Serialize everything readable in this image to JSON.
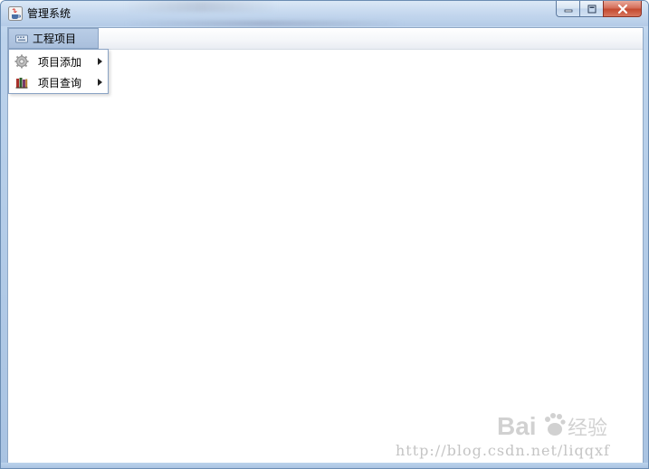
{
  "window": {
    "title": "管理系统",
    "controls": [
      "minimize",
      "maximize",
      "close"
    ]
  },
  "menubar": {
    "menus": [
      {
        "label": "工程项目",
        "icon": "keyboard-icon",
        "open": true,
        "items": [
          {
            "label": "项目添加",
            "icon": "gear-icon",
            "has_submenu": true
          },
          {
            "label": "项目查询",
            "icon": "books-icon",
            "has_submenu": true
          }
        ]
      }
    ]
  },
  "watermark": {
    "url": "http://blog.csdn.net/liqqxf"
  },
  "colors": {
    "titlebar": "#c6d9ef",
    "menu_highlight": "#b9cde6",
    "close_button": "#c44a30"
  }
}
